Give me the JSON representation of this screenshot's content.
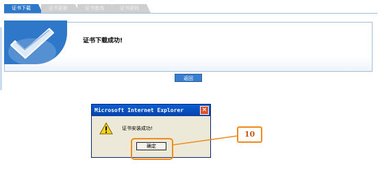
{
  "tabs": [
    {
      "label": "证书下载",
      "active": true
    },
    {
      "label": "证书更新",
      "active": false
    },
    {
      "label": "证书查询",
      "active": false
    },
    {
      "label": "证书密码",
      "active": false
    }
  ],
  "panel": {
    "message": "证书下载成功!",
    "icon": "check-icon"
  },
  "back_button": "返回",
  "dialog": {
    "title": "Microsoft Internet Explorer",
    "message": "证书安装成功!",
    "ok_label": "确定",
    "icon": "warning-icon"
  },
  "annotation": {
    "step": "10"
  },
  "colors": {
    "accent": "#2f78c9",
    "highlight": "#f08a1a",
    "dialog_title": "#0a5fd6"
  }
}
